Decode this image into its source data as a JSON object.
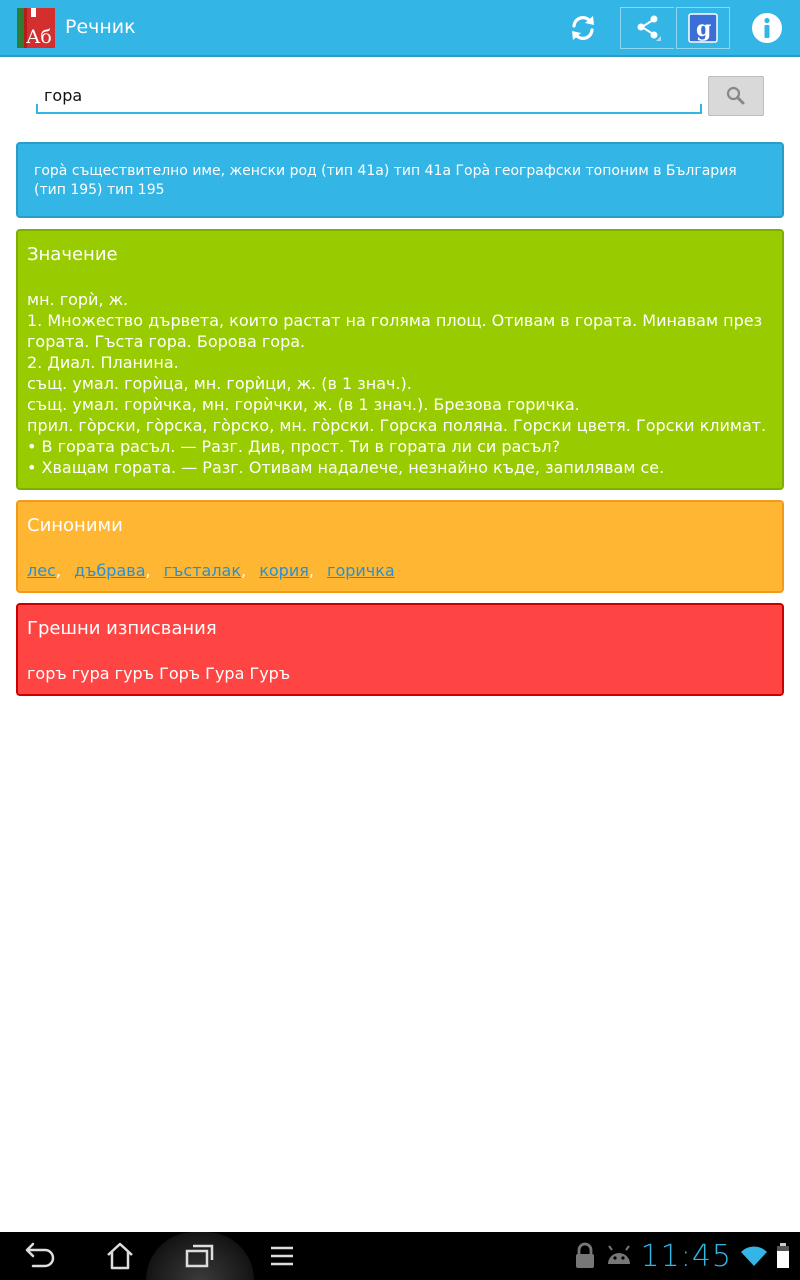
{
  "action_bar": {
    "app_icon_text": "Аб",
    "title": "Речник",
    "buttons": [
      "refresh-icon",
      "share-icon",
      "google-icon",
      "info-icon"
    ],
    "google_glyph": "g"
  },
  "search": {
    "value": "гора",
    "button_icon": "search-icon"
  },
  "info_card": {
    "text": "горà съществително име, женски род (тип 41а) тип 41а Горà географски топоним в България (тип 195) тип 195"
  },
  "meaning_card": {
    "title": "Значение",
    "body": "мн. горѝ, ж.\n1. Множество дървета, които растат на голяма площ. Отивам в гората. Минавам през гората. Гъста гора. Борова гора.\n2. Диал. Планина.\nсъщ. умал. горѝца, мн. горѝци, ж. (в 1 знач.).\nсъщ. умал. горѝчка, мн. горѝчки, ж. (в 1 знач.). Брезова горичка.\nприл. гòрски, гòрска, гòрско, мн. гòрски. Горска поляна. Горски цветя. Горски климат.\n• В гората расъл. — Разг. Див, прост. Ти в гората ли си расъл?\n• Хващам гората. — Разг. Отивам надалече, незнайно къде, запилявам се."
  },
  "synonyms_card": {
    "title": "Синоними",
    "items": [
      "лес",
      "дъбрава",
      "гъсталак",
      "кория",
      "горичка"
    ],
    "separator": ","
  },
  "misspellings_card": {
    "title": "Грешни изписвания",
    "body": "горъ гура гуръ Горъ Гура Гуръ"
  },
  "system_bar": {
    "clock": "11:45",
    "nav_buttons": [
      "back-icon",
      "home-icon",
      "recents-icon",
      "menu-icon"
    ],
    "status_icons": [
      "lock-icon",
      "android-icon",
      "wifi-icon",
      "battery-icon"
    ]
  },
  "colors": {
    "accent_blue": "#33b5e5",
    "green": "#99cc00",
    "orange": "#ffb733",
    "red": "#ff4444"
  }
}
